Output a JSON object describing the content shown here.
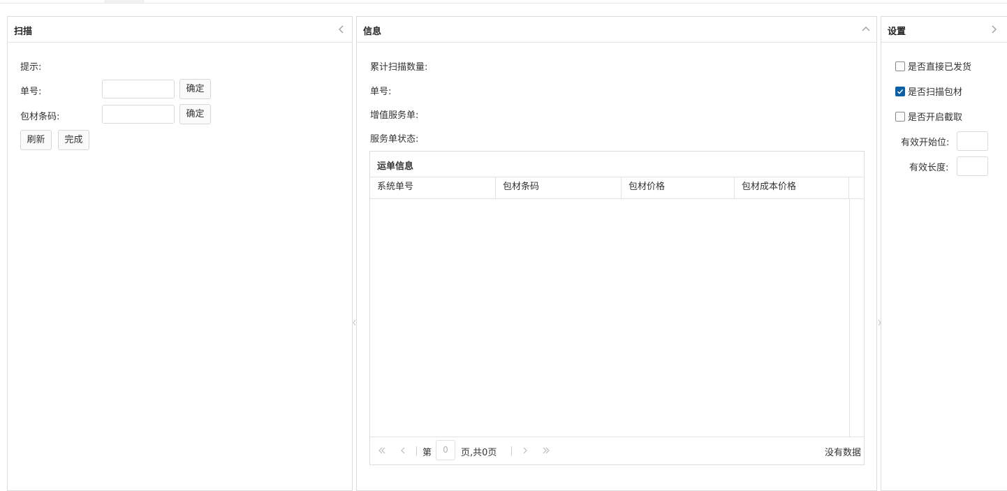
{
  "scan_panel": {
    "title": "扫描",
    "hint_label": "提示:",
    "order_label": "单号:",
    "order_value": "",
    "order_confirm": "确定",
    "barcode_label": "包材条码:",
    "barcode_value": "",
    "barcode_confirm": "确定",
    "refresh": "刷新",
    "finish": "完成",
    "collapse_icon": "chevron-left-icon"
  },
  "info_panel": {
    "title": "信息",
    "total_scanned_label": "累计扫描数量:",
    "order_label": "单号:",
    "value_added_label": "增值服务单:",
    "service_status_label": "服务单状态:",
    "collapse_icon": "chevron-up-icon",
    "grid": {
      "title": "运单信息",
      "columns": [
        "系统单号",
        "包材条码",
        "包材价格",
        "包材成本价格"
      ],
      "rows": [],
      "pager": {
        "page_prefix": "第",
        "page_value": "0",
        "page_suffix": "页,共0页",
        "status": "没有数据"
      }
    }
  },
  "settings_panel": {
    "title": "设置",
    "collapse_icon": "chevron-right-icon",
    "options": [
      {
        "label": "是否直接已发货",
        "checked": false
      },
      {
        "label": "是否扫描包材",
        "checked": true
      },
      {
        "label": "是否开启截取",
        "checked": false
      }
    ],
    "start_pos_label": "有效开始位:",
    "start_pos_value": "",
    "length_label": "有效长度:",
    "length_value": ""
  },
  "colors": {
    "accent": "#0b5fa5",
    "border": "#dcdcdc"
  }
}
